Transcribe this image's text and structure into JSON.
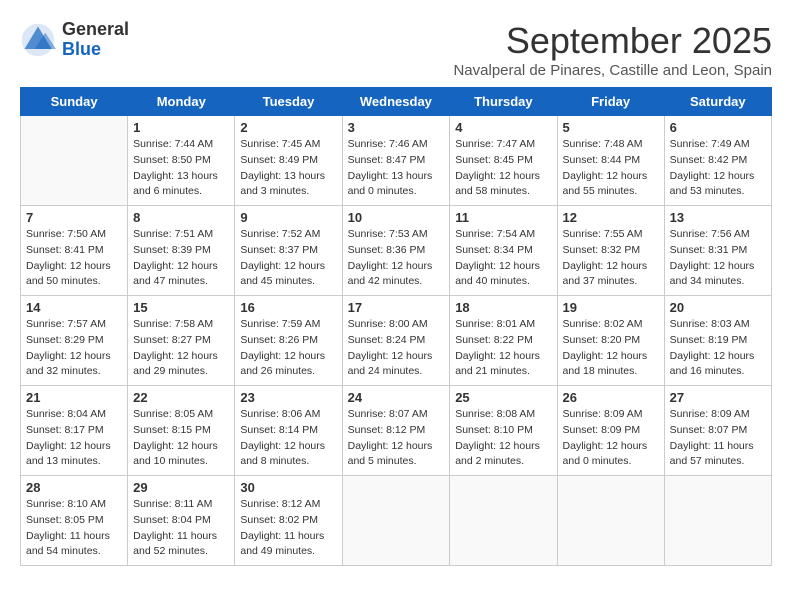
{
  "logo": {
    "general": "General",
    "blue": "Blue"
  },
  "title": "September 2025",
  "subtitle": "Navalperal de Pinares, Castille and Leon, Spain",
  "days_of_week": [
    "Sunday",
    "Monday",
    "Tuesday",
    "Wednesday",
    "Thursday",
    "Friday",
    "Saturday"
  ],
  "weeks": [
    [
      {
        "day": "",
        "info": ""
      },
      {
        "day": "1",
        "info": "Sunrise: 7:44 AM\nSunset: 8:50 PM\nDaylight: 13 hours\nand 6 minutes."
      },
      {
        "day": "2",
        "info": "Sunrise: 7:45 AM\nSunset: 8:49 PM\nDaylight: 13 hours\nand 3 minutes."
      },
      {
        "day": "3",
        "info": "Sunrise: 7:46 AM\nSunset: 8:47 PM\nDaylight: 13 hours\nand 0 minutes."
      },
      {
        "day": "4",
        "info": "Sunrise: 7:47 AM\nSunset: 8:45 PM\nDaylight: 12 hours\nand 58 minutes."
      },
      {
        "day": "5",
        "info": "Sunrise: 7:48 AM\nSunset: 8:44 PM\nDaylight: 12 hours\nand 55 minutes."
      },
      {
        "day": "6",
        "info": "Sunrise: 7:49 AM\nSunset: 8:42 PM\nDaylight: 12 hours\nand 53 minutes."
      }
    ],
    [
      {
        "day": "7",
        "info": "Sunrise: 7:50 AM\nSunset: 8:41 PM\nDaylight: 12 hours\nand 50 minutes."
      },
      {
        "day": "8",
        "info": "Sunrise: 7:51 AM\nSunset: 8:39 PM\nDaylight: 12 hours\nand 47 minutes."
      },
      {
        "day": "9",
        "info": "Sunrise: 7:52 AM\nSunset: 8:37 PM\nDaylight: 12 hours\nand 45 minutes."
      },
      {
        "day": "10",
        "info": "Sunrise: 7:53 AM\nSunset: 8:36 PM\nDaylight: 12 hours\nand 42 minutes."
      },
      {
        "day": "11",
        "info": "Sunrise: 7:54 AM\nSunset: 8:34 PM\nDaylight: 12 hours\nand 40 minutes."
      },
      {
        "day": "12",
        "info": "Sunrise: 7:55 AM\nSunset: 8:32 PM\nDaylight: 12 hours\nand 37 minutes."
      },
      {
        "day": "13",
        "info": "Sunrise: 7:56 AM\nSunset: 8:31 PM\nDaylight: 12 hours\nand 34 minutes."
      }
    ],
    [
      {
        "day": "14",
        "info": "Sunrise: 7:57 AM\nSunset: 8:29 PM\nDaylight: 12 hours\nand 32 minutes."
      },
      {
        "day": "15",
        "info": "Sunrise: 7:58 AM\nSunset: 8:27 PM\nDaylight: 12 hours\nand 29 minutes."
      },
      {
        "day": "16",
        "info": "Sunrise: 7:59 AM\nSunset: 8:26 PM\nDaylight: 12 hours\nand 26 minutes."
      },
      {
        "day": "17",
        "info": "Sunrise: 8:00 AM\nSunset: 8:24 PM\nDaylight: 12 hours\nand 24 minutes."
      },
      {
        "day": "18",
        "info": "Sunrise: 8:01 AM\nSunset: 8:22 PM\nDaylight: 12 hours\nand 21 minutes."
      },
      {
        "day": "19",
        "info": "Sunrise: 8:02 AM\nSunset: 8:20 PM\nDaylight: 12 hours\nand 18 minutes."
      },
      {
        "day": "20",
        "info": "Sunrise: 8:03 AM\nSunset: 8:19 PM\nDaylight: 12 hours\nand 16 minutes."
      }
    ],
    [
      {
        "day": "21",
        "info": "Sunrise: 8:04 AM\nSunset: 8:17 PM\nDaylight: 12 hours\nand 13 minutes."
      },
      {
        "day": "22",
        "info": "Sunrise: 8:05 AM\nSunset: 8:15 PM\nDaylight: 12 hours\nand 10 minutes."
      },
      {
        "day": "23",
        "info": "Sunrise: 8:06 AM\nSunset: 8:14 PM\nDaylight: 12 hours\nand 8 minutes."
      },
      {
        "day": "24",
        "info": "Sunrise: 8:07 AM\nSunset: 8:12 PM\nDaylight: 12 hours\nand 5 minutes."
      },
      {
        "day": "25",
        "info": "Sunrise: 8:08 AM\nSunset: 8:10 PM\nDaylight: 12 hours\nand 2 minutes."
      },
      {
        "day": "26",
        "info": "Sunrise: 8:09 AM\nSunset: 8:09 PM\nDaylight: 12 hours\nand 0 minutes."
      },
      {
        "day": "27",
        "info": "Sunrise: 8:09 AM\nSunset: 8:07 PM\nDaylight: 11 hours\nand 57 minutes."
      }
    ],
    [
      {
        "day": "28",
        "info": "Sunrise: 8:10 AM\nSunset: 8:05 PM\nDaylight: 11 hours\nand 54 minutes."
      },
      {
        "day": "29",
        "info": "Sunrise: 8:11 AM\nSunset: 8:04 PM\nDaylight: 11 hours\nand 52 minutes."
      },
      {
        "day": "30",
        "info": "Sunrise: 8:12 AM\nSunset: 8:02 PM\nDaylight: 11 hours\nand 49 minutes."
      },
      {
        "day": "",
        "info": ""
      },
      {
        "day": "",
        "info": ""
      },
      {
        "day": "",
        "info": ""
      },
      {
        "day": "",
        "info": ""
      }
    ]
  ]
}
